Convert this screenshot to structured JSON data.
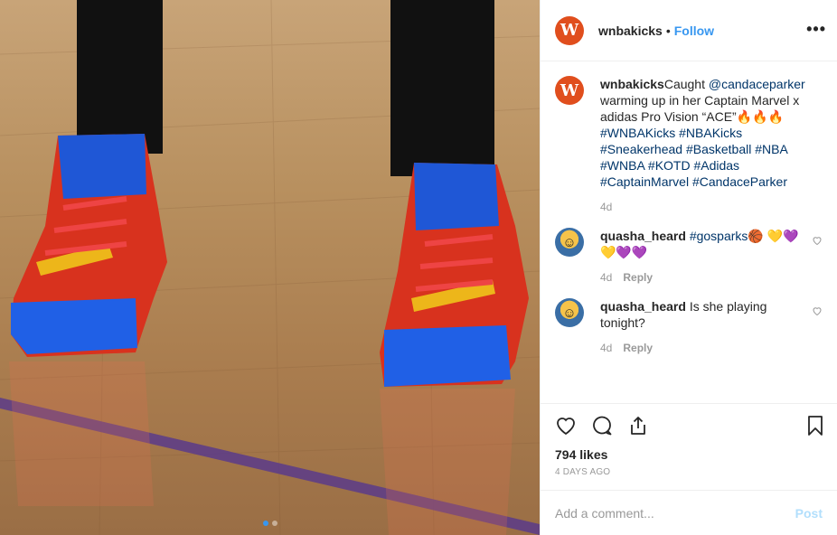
{
  "post": {
    "username": "wnbakicks",
    "avatar_letter": "W",
    "separator": "•",
    "follow_label": "Follow",
    "more_label": "•••",
    "likes": "794 likes",
    "time_ago": "4 DAYS AGO",
    "carousel": {
      "count": 2,
      "active_index": 0
    }
  },
  "caption": {
    "username": "wnbakicks",
    "text_1": "Caught ",
    "mention": "@candaceparker",
    "text_2": " warming up in her Captain Marvel x adidas Pro Vision “ACE”",
    "emoji": "🔥🔥🔥",
    "hashtags": "#WNBAKicks #NBAKicks #Sneakerhead #Basketball #NBA #WNBA #KOTD #Adidas #CaptainMarvel #CandaceParker",
    "time": "4d"
  },
  "comments": [
    {
      "username": "quasha_heard",
      "hashtag": "#gosparks",
      "emoji": "🏀 💛💜💛💜💜",
      "time": "4d",
      "reply_label": "Reply",
      "avatar_glyph": "☺"
    },
    {
      "username": "quasha_heard",
      "text": "Is she playing tonight?",
      "time": "4d",
      "reply_label": "Reply",
      "avatar_glyph": "☺"
    }
  ],
  "add_comment": {
    "placeholder": "Add a comment...",
    "post_label": "Post"
  },
  "colors": {
    "accent_blue": "#3897f0",
    "link_dark": "#003569",
    "brand_orange": "#e04e1d",
    "post_disabled": "#b2dffc"
  },
  "icons": [
    "heart-icon",
    "comment-icon",
    "share-icon",
    "bookmark-icon",
    "more-options-icon"
  ]
}
